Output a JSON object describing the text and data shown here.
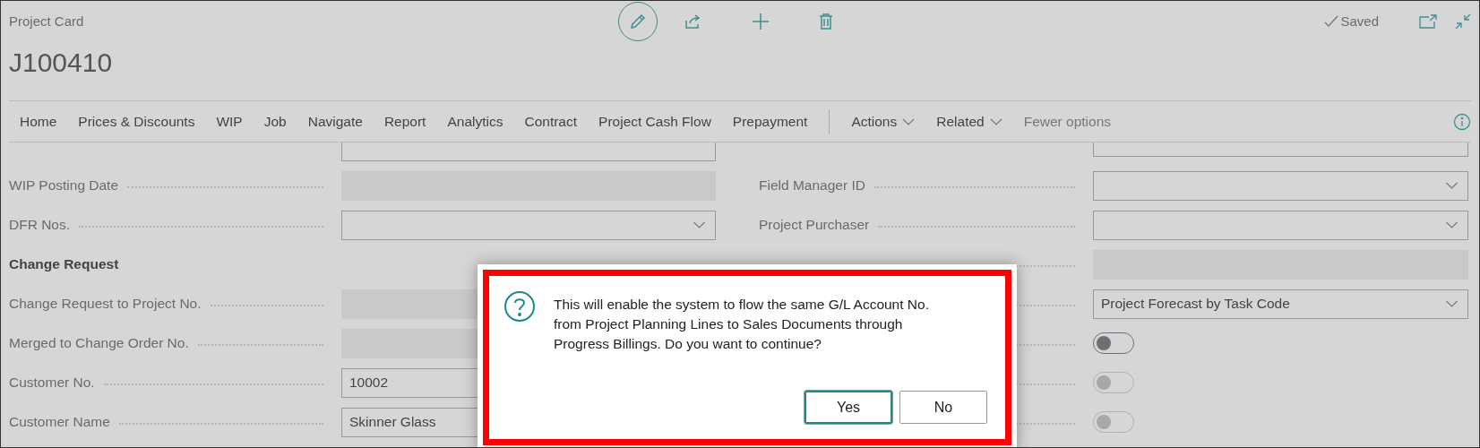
{
  "header": {
    "caption": "Project Card",
    "title": "J100410",
    "status": "Saved"
  },
  "nav": [
    {
      "label": "Home",
      "kind": "tab"
    },
    {
      "label": "Prices & Discounts",
      "kind": "tab"
    },
    {
      "label": "WIP",
      "kind": "tab"
    },
    {
      "label": "Job",
      "kind": "tab"
    },
    {
      "label": "Navigate",
      "kind": "tab"
    },
    {
      "label": "Report",
      "kind": "tab"
    },
    {
      "label": "Analytics",
      "kind": "tab"
    },
    {
      "label": "Contract",
      "kind": "tab"
    },
    {
      "label": "Project Cash Flow",
      "kind": "tab"
    },
    {
      "label": "Prepayment",
      "kind": "tab"
    },
    {
      "label": "Actions",
      "kind": "menu"
    },
    {
      "label": "Related",
      "kind": "menu"
    },
    {
      "label": "Fewer options",
      "kind": "link"
    }
  ],
  "left_fields": [
    {
      "kind": "cutoff"
    },
    {
      "label": "WIP Posting Date",
      "kind": "disabled"
    },
    {
      "label": "DFR Nos.",
      "kind": "dropdown"
    },
    {
      "label": "Change Request",
      "kind": "heading"
    },
    {
      "label": "Change Request to Project No.",
      "kind": "disabled"
    },
    {
      "label": "Merged to Change Order No.",
      "kind": "disabled"
    },
    {
      "label": "Customer No.",
      "kind": "text",
      "value": "10002"
    },
    {
      "label": "Customer Name",
      "kind": "text",
      "value": "Skinner Glass"
    }
  ],
  "right_fields": [
    {
      "kind": "cutoff"
    },
    {
      "label": "Field Manager ID",
      "kind": "dropdown"
    },
    {
      "label": "Project Purchaser",
      "kind": "dropdown"
    },
    {
      "kind": "disabled"
    },
    {
      "kind": "dropdown",
      "value": "Project Forecast by Task Code"
    },
    {
      "kind": "toggle",
      "on": false,
      "disabled": false
    },
    {
      "kind": "toggle",
      "on": false,
      "disabled": true
    },
    {
      "kind": "toggle",
      "on": false,
      "disabled": true
    }
  ],
  "dialog": {
    "message": "This will enable the system to flow the same G/L Account No. from Project Planning Lines to Sales Documents through Progress Billings. Do you want to continue?",
    "buttons": [
      {
        "label": "Yes",
        "selected": true
      },
      {
        "label": "No",
        "selected": false
      }
    ]
  }
}
